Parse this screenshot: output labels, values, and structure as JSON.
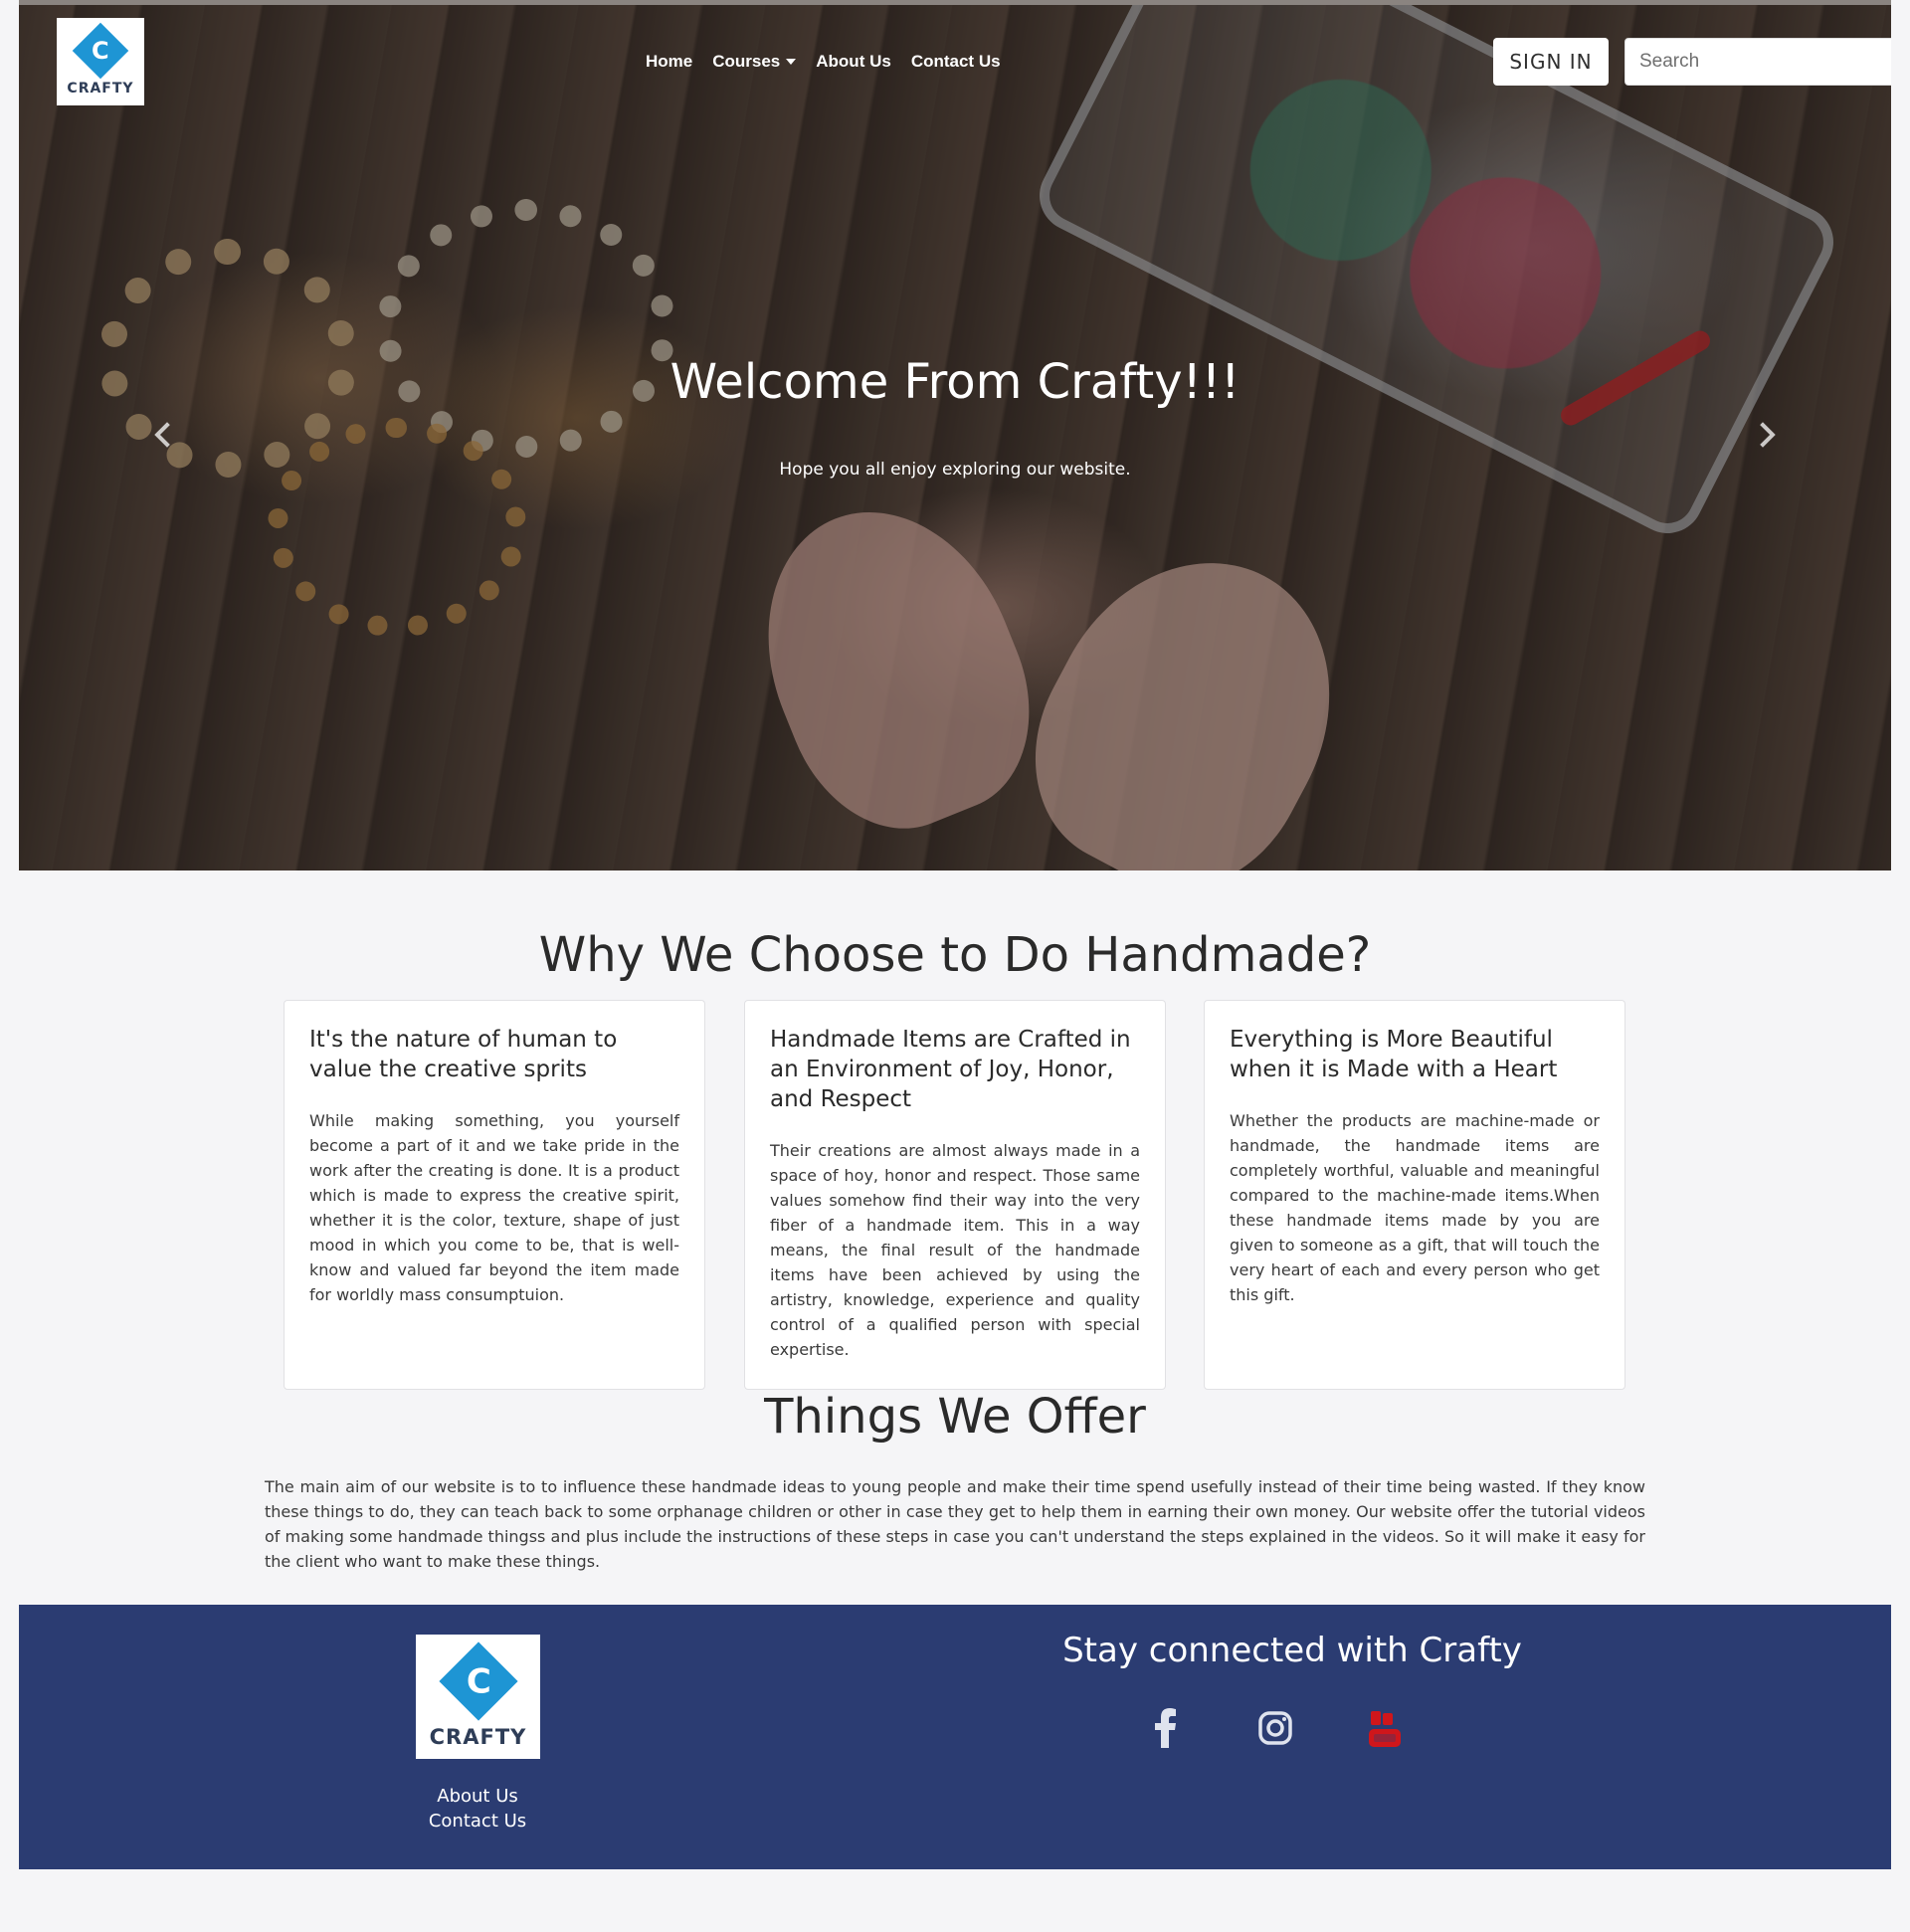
{
  "brand": {
    "logo_letter": "C",
    "logo_text": "CRAFTY"
  },
  "nav": {
    "items": [
      {
        "label": "Home"
      },
      {
        "label": "Courses"
      },
      {
        "label": "About Us"
      },
      {
        "label": "Contact Us"
      }
    ],
    "signin_label": "SIGN IN",
    "search_placeholder": "Search"
  },
  "hero": {
    "title": "Welcome From Crafty!!!",
    "subtitle": "Hope you all enjoy exploring our website."
  },
  "why": {
    "title": "Why We Choose to Do Handmade?",
    "cards": [
      {
        "title": "It's the nature of human to value the creative sprits",
        "text": "While making something, you yourself become a part of it and we take pride in the work after the creating is done. It is a product which is made to express the creative spirit, whether it is the color, texture, shape of just mood in which you come to be, that is well-know and valued far beyond the item made for worldly mass consumptuion."
      },
      {
        "title": "Handmade Items are Crafted in an Environment of Joy, Honor, and Respect",
        "text": "Their creations are almost always made in a space of hoy, honor and respect. Those same values somehow find their way into the very fiber of a handmade item. This in a way means, the final result of the handmade items have been achieved by using the artistry, knowledge, experience and quality control of a qualified person with special expertise."
      },
      {
        "title": "Everything is More Beautiful when it is Made with a Heart",
        "text": "Whether the products are machine-made or handmade, the handmade items are completely worthful, valuable and meaningful compared to the machine-made items.When these handmade items made by you are given to someone as a gift, that will touch the very heart of each and every person who get this gift."
      }
    ]
  },
  "offer": {
    "title": "Things We Offer",
    "text": "The main aim of our website is to to influence these handmade ideas to young people and make their time spend usefully instead of their time being wasted. If they know these things to do, they can teach back to some orphanage children or other in case they get to help them in earning their own money. Our website offer the tutorial videos of making some handmade thingss and plus include the instructions of these steps in case you can't understand the steps explained in the videos. So it will make it easy for the client who want to make these things."
  },
  "footer": {
    "about_label": "About Us",
    "contact_label": "Contact Us",
    "stay_title": "Stay connected with Crafty",
    "social": [
      {
        "icon": "facebook-icon"
      },
      {
        "icon": "instagram-icon"
      },
      {
        "icon": "youtube-icon"
      }
    ]
  },
  "colors": {
    "footer_bg": "#2b3c72",
    "logo_blue": "#1e95d4",
    "youtube_red": "#d0161b"
  }
}
